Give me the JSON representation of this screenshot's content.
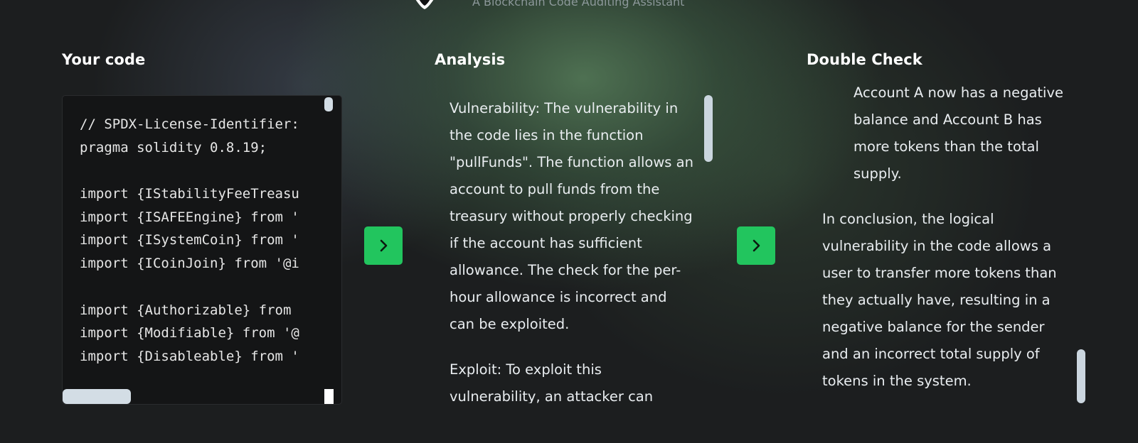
{
  "header": {
    "subtitle": "A Blockchain Code Auditing Assistant",
    "logo_icon": "shield-logo-icon"
  },
  "columns": {
    "code": {
      "title": "Your code"
    },
    "analysis": {
      "title": "Analysis"
    },
    "double_check": {
      "title": "Double Check"
    }
  },
  "code_panel": {
    "lines": [
      "// SPDX-License-Identifier:",
      "pragma solidity 0.8.19;",
      "",
      "import {IStabilityFeeTreasu",
      "import {ISAFEEngine} from '",
      "import {ISystemCoin} from '",
      "import {ICoinJoin} from '@i",
      "",
      "import {Authorizable} from ",
      "import {Modifiable} from '@",
      "import {Disableable} from '"
    ]
  },
  "buttons": {
    "analyze_icon": "chevron-right-icon",
    "double_check_icon": "chevron-right-icon"
  },
  "analysis": {
    "paragraphs": [
      "Vulnerability: The vulnerability in the code lies in the function \"pullFunds\". The function allows an account to pull funds from the treasury without properly checking if the account has sufficient allowance. The check for the per-hour allowance is incorrect and can be exploited.",
      "Exploit: To exploit this vulnerability, an attacker can"
    ]
  },
  "double_check": {
    "indented_text": "Account A now has a negative balance and Account B has more tokens than the total supply.",
    "conclusion": "In conclusion, the logical vulnerability in the code allows a user to transfer more tokens than they actually have, resulting in a negative balance for the sender and an incorrect total supply of tokens in the system."
  },
  "colors": {
    "accent_green": "#22c55e",
    "code_background": "#141516",
    "scrollbar": "#cbd6df"
  }
}
